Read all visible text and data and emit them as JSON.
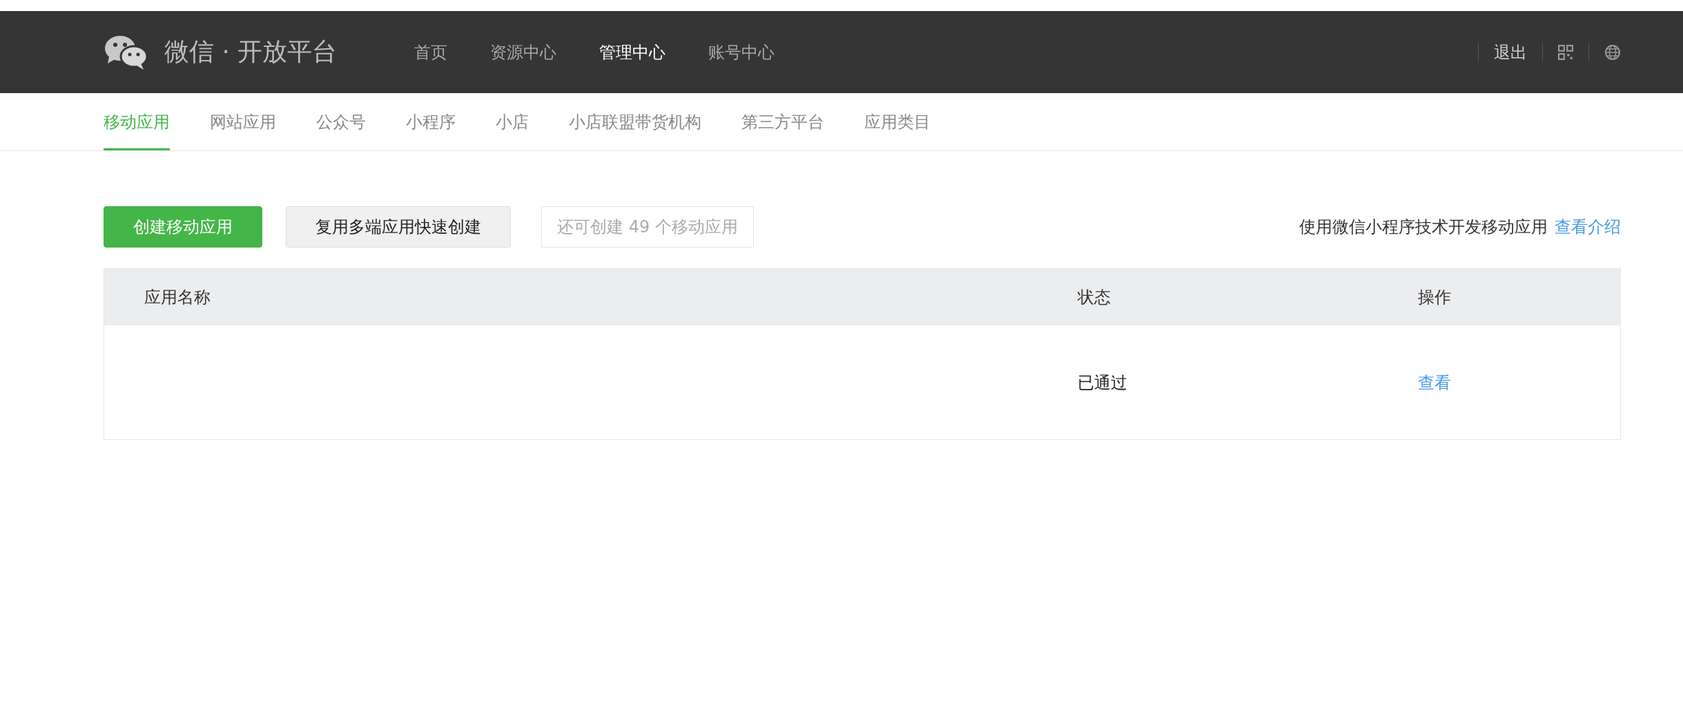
{
  "header": {
    "logo_text": "微信 · 开放平台",
    "nav": [
      {
        "label": "首页",
        "selected": false
      },
      {
        "label": "资源中心",
        "selected": false
      },
      {
        "label": "管理中心",
        "selected": true
      },
      {
        "label": "账号中心",
        "selected": false
      }
    ],
    "logout": "退出"
  },
  "tabs": [
    {
      "label": "移动应用",
      "selected": true
    },
    {
      "label": "网站应用",
      "selected": false
    },
    {
      "label": "公众号",
      "selected": false
    },
    {
      "label": "小程序",
      "selected": false
    },
    {
      "label": "小店",
      "selected": false
    },
    {
      "label": "小店联盟带货机构",
      "selected": false
    },
    {
      "label": "第三方平台",
      "selected": false
    },
    {
      "label": "应用类目",
      "selected": false
    }
  ],
  "toolbar": {
    "create_button": "创建移动应用",
    "reuse_button": "复用多端应用快速创建",
    "quota_tip": "还可创建 49 个移动应用",
    "intro_text": "使用微信小程序技术开发移动应用",
    "intro_link": "查看介绍"
  },
  "table": {
    "columns": [
      "应用名称",
      "状态",
      "操作"
    ],
    "rows": [
      {
        "status": "已通过",
        "action": "查看"
      }
    ]
  }
}
